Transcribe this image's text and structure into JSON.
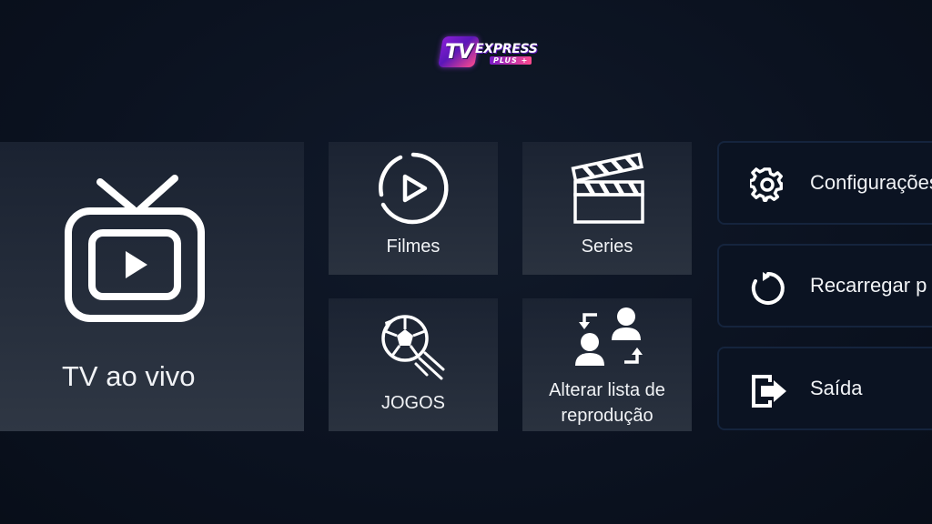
{
  "logo": {
    "badge": "TV",
    "word": "EXPRESS",
    "sub": "PLUS +"
  },
  "tiles": {
    "live": {
      "label": "TV ao vivo",
      "icon": "tv-icon"
    },
    "movies": {
      "label": "Filmes",
      "icon": "play-circle-icon"
    },
    "series": {
      "label": "Series",
      "icon": "clapperboard-icon"
    },
    "sports": {
      "label": "JOGOS",
      "icon": "soccer-ball-icon"
    },
    "playlist": {
      "label_line1": "Alterar lista de",
      "label_line2": "reprodução",
      "icon": "switch-users-icon"
    }
  },
  "side_buttons": {
    "settings": {
      "label": "Configurações",
      "icon": "gear-icon"
    },
    "reload": {
      "label": "Recarregar p",
      "icon": "reload-icon"
    },
    "exit": {
      "label": "Saída",
      "icon": "exit-icon"
    }
  },
  "colors": {
    "background": "#0b1220",
    "tile": "#2a323f",
    "button_border": "#15243d",
    "text": "#f1f3f6"
  }
}
